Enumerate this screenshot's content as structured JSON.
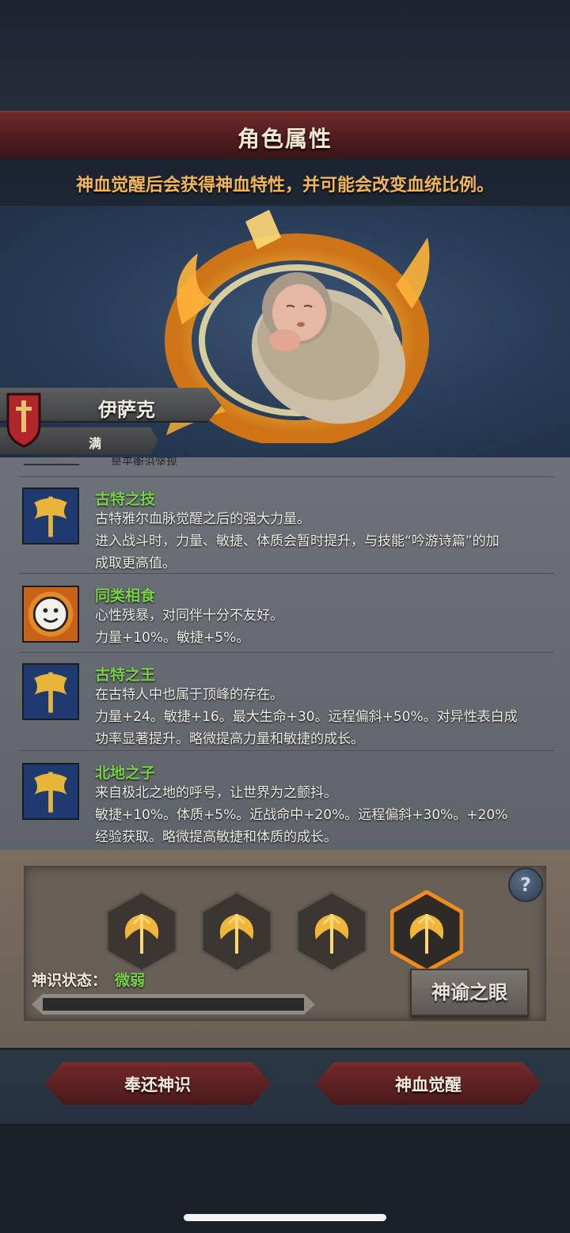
{
  "header": {
    "title": "角色属性"
  },
  "hint": "神血觉醒后会获得神血特性，并可能会改变血统比例。",
  "character": {
    "name": "伊萨克",
    "level_label": "满"
  },
  "traits_cut_text": "是平衡沿坚现",
  "traits": [
    {
      "name": "古特之技",
      "icon": "golden-axe-icon",
      "lines": [
        "古特雅尔血脉觉醒之后的强大力量。",
        "进入战斗时，力量、敏捷、体质会暂时提升，与技能“吟游诗篇”的加",
        "成取更高值。"
      ]
    },
    {
      "name": "同类相食",
      "icon": "smiley-sun-icon",
      "lines": [
        "心性残暴，对同伴十分不友好。",
        "力量+10%。敏捷+5%。"
      ]
    },
    {
      "name": "古特之王",
      "icon": "golden-axe-icon",
      "lines": [
        "在古特人中也属于顶峰的存在。",
        "力量+24。敏捷+16。最大生命+30。远程偏斜+50%。对异性表白成",
        "功率显著提升。略微提高力量和敏捷的成长。"
      ]
    },
    {
      "name": "北地之子",
      "icon": "golden-axe-icon",
      "lines": [
        "来自极北之地的呼号，让世界为之颤抖。",
        "敏捷+10%。体质+5%。近战命中+20%。远程偏斜+30%。+20%",
        "经验获取。略微提高敏捷和体质的成长。"
      ]
    }
  ],
  "divine": {
    "help_label": "?",
    "status_label": "神识状态：",
    "status_value": "微弱",
    "progress": 0,
    "oracle_button": "神谕之眼",
    "slots": [
      {
        "icon": "flaming-trident-icon",
        "selected": false
      },
      {
        "icon": "flaming-trident-icon",
        "selected": false
      },
      {
        "icon": "flaming-trident-icon",
        "selected": false
      },
      {
        "icon": "flaming-trident-icon",
        "selected": true
      }
    ]
  },
  "actions": {
    "return_label": "奉还神识",
    "awaken_label": "神血觉醒"
  },
  "colors": {
    "trait_name": "#7ad24a",
    "hint": "#f2b65a",
    "title_bar": "#5a2224"
  }
}
